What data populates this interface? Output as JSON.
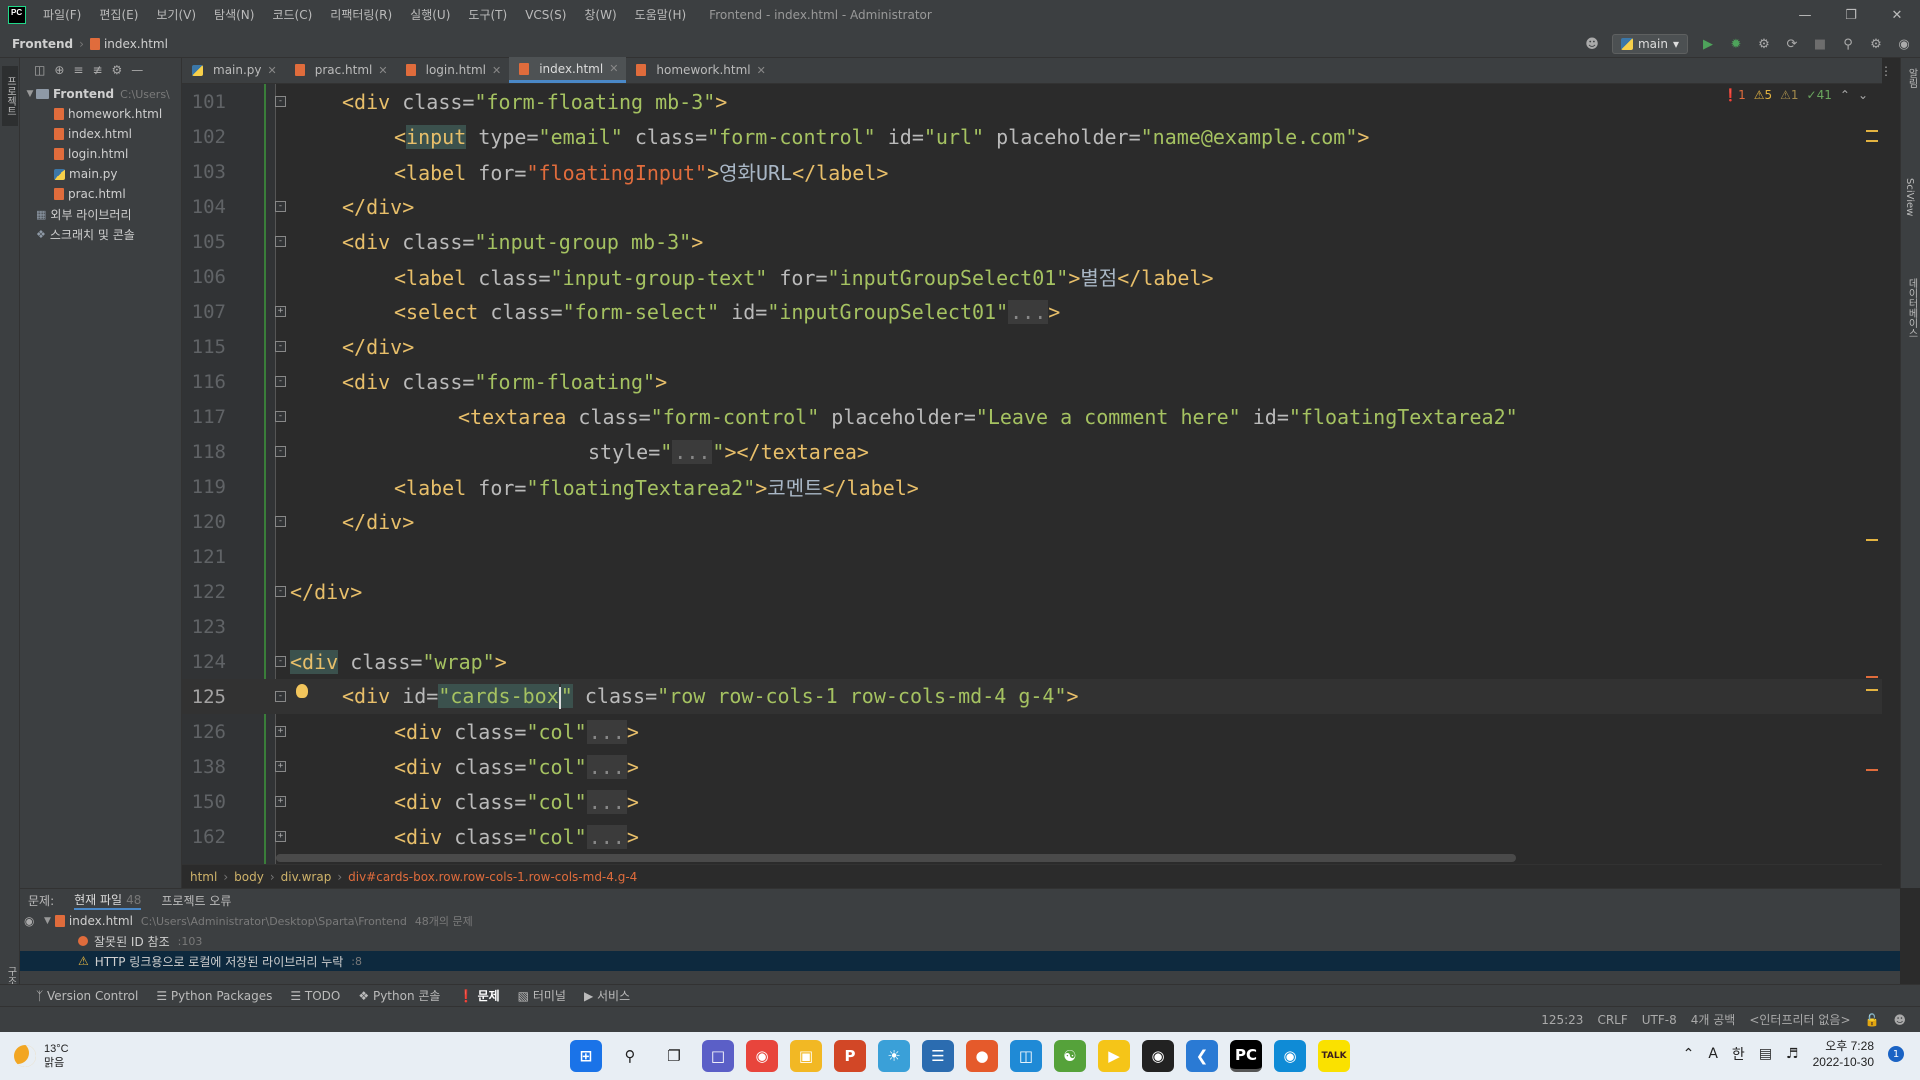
{
  "window": {
    "title": "Frontend - index.html - Administrator",
    "logo": "PC",
    "menu": [
      "파일(F)",
      "편집(E)",
      "보기(V)",
      "탐색(N)",
      "코드(C)",
      "리팩터링(R)",
      "실행(U)",
      "도구(T)",
      "VCS(S)",
      "창(W)",
      "도움말(H)"
    ]
  },
  "navbar": {
    "project": "Frontend",
    "file": "index.html",
    "run_config": "main"
  },
  "project_panel": {
    "root": "Frontend",
    "root_path": "C:\\Users\\",
    "files": [
      "homework.html",
      "index.html",
      "login.html",
      "main.py",
      "prac.html"
    ],
    "external": "외부 라이브러리",
    "scratches": "스크래치 및 콘솔"
  },
  "left_strip_label": "프로젝트",
  "left_strip_bottom_label": "구조",
  "tabs": [
    {
      "label": "main.py"
    },
    {
      "label": "prac.html"
    },
    {
      "label": "login.html"
    },
    {
      "label": "index.html"
    },
    {
      "label": "homework.html"
    }
  ],
  "inspections": {
    "errors": "1",
    "warnings": "5",
    "weak": "1",
    "ok": "41"
  },
  "right_strip": [
    "알림",
    "SciView",
    "데이터베이스"
  ],
  "code_lines": [
    {
      "n": "101"
    },
    {
      "n": "102"
    },
    {
      "n": "103"
    },
    {
      "n": "104"
    },
    {
      "n": "105"
    },
    {
      "n": "106"
    },
    {
      "n": "107"
    },
    {
      "n": "115"
    },
    {
      "n": "116"
    },
    {
      "n": "117"
    },
    {
      "n": "118"
    },
    {
      "n": "119"
    },
    {
      "n": "120"
    },
    {
      "n": "121"
    },
    {
      "n": "122"
    },
    {
      "n": "123"
    },
    {
      "n": "124"
    },
    {
      "n": "125"
    },
    {
      "n": "126"
    },
    {
      "n": "138"
    },
    {
      "n": "150"
    },
    {
      "n": "162"
    }
  ],
  "breadcrumb": [
    "html",
    "body",
    "div.wrap",
    "div#cards-box.row.row-cols-1.row-cols-md-4.g-4"
  ],
  "problems": {
    "label": "문제:",
    "tab_current": "현재 파일",
    "tab_current_count": "48",
    "tab_project": "프로젝트 오류",
    "file": "index.html",
    "file_path": "C:\\Users\\Administrator\\Desktop\\Sparta\\Frontend",
    "file_count": "48개의 문제",
    "row1": "잘못된 ID 참조",
    "row1_line": ":103",
    "row2": "HTTP 링크용으로 로컬에 저장된 라이브러리 누락",
    "row2_line": ":8"
  },
  "tool_tabs": [
    "Version Control",
    "Python Packages",
    "TODO",
    "Python 콘솔",
    "문제",
    "터미널",
    "서비스"
  ],
  "status": {
    "position": "125:23",
    "line_sep": "CRLF",
    "encoding": "UTF-8",
    "indent": "4개 공백",
    "interpreter": "<인터프리터 없음>"
  },
  "taskbar": {
    "temp": "13°C",
    "weather": "맑음",
    "time": "오후 7:28",
    "date": "2022-10-30",
    "ime": "한",
    "notif_count": "1"
  }
}
